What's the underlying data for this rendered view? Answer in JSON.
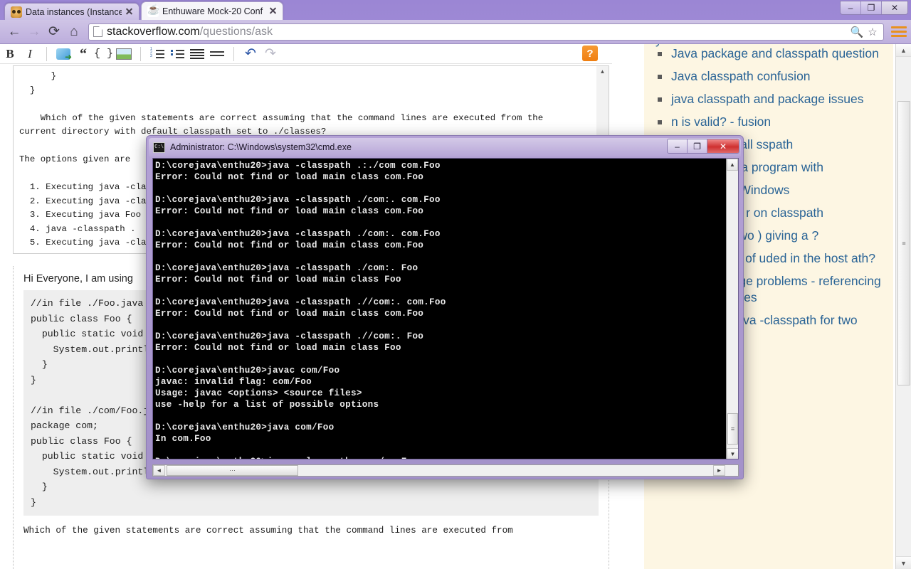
{
  "browser": {
    "tabs": [
      {
        "title": "Data instances (Instance)",
        "favicon": "face-icon",
        "active": false
      },
      {
        "title": "Enthuware Mock-20 Conf",
        "favicon": "java-icon",
        "active": true
      }
    ],
    "window_controls": {
      "minimize": "–",
      "maximize": "❐",
      "close": "✕"
    },
    "nav": {
      "back": "←",
      "forward": "→",
      "reload": "⟳",
      "home": "⌂"
    },
    "omnibox": {
      "url_domain": "stackoverflow.com",
      "url_path": "/questions/ask",
      "search_icon": "🔍",
      "bookmark_icon": "☆"
    },
    "menu_icon": "hamburger-menu-icon"
  },
  "editor": {
    "toolbar": [
      {
        "name": "bold-button",
        "label": "B"
      },
      {
        "name": "italic-button",
        "label": "I"
      },
      {
        "name": "hyperlink-button",
        "label": ""
      },
      {
        "name": "blockquote-button",
        "label": "“"
      },
      {
        "name": "code-sample-button",
        "label": "{ }"
      },
      {
        "name": "image-button",
        "label": ""
      },
      {
        "name": "numbered-list-button",
        "label": ""
      },
      {
        "name": "bulleted-list-button",
        "label": ""
      },
      {
        "name": "heading-button",
        "label": ""
      },
      {
        "name": "horizontal-rule-button",
        "label": ""
      },
      {
        "name": "undo-button",
        "label": "↶"
      },
      {
        "name": "redo-button",
        "label": "↷"
      }
    ],
    "help_label": "?",
    "body_text": "      }\n  }\n\n    Which of the given statements are correct assuming that the command lines are executed from the\ncurrent directory with default classpath set to ./classes?\n\nThe options given are\n\n  1. Executing java -classpath\n  2. Executing java -classpath\n  3. Executing java Foo\n  4. java -classpath .\n  5. Executing java -classpath\n\nCorrect option given i\ncommand line it gives",
    "scrollbar_up": "▲"
  },
  "preview": {
    "intro": "Hi Everyone, I am using",
    "code_block": "//in file ./Foo.java\npublic class Foo {\n  public static void main(String[] args) {\n    System.out.println(\"In Foo\");\n  }\n}\n\n//in file ./com/Foo.java\npackage com;\npublic class Foo {\n  public static void main(String[] args) {\n    System.out.println(\"In com.Foo\");\n  }\n}",
    "tail": "Which of the given statements are correct assuming that the command lines are executed from"
  },
  "sidebar": {
    "clipped_top": "y",
    "related": [
      "Java package and classpath question",
      "Java classpath confusion",
      "java classpath and package issues",
      "n is valid? - fusion",
      "and “.” in a call sspath",
      "ut compiling a program with",
      "arding Java Windows",
      "does not see r on classpath",
      "cting these two ) giving a ?",
      "ed packages of uded in the host ath?",
      "n and package problems - referencing multiple jar files",
      "How to set java -classpath for two directories?"
    ]
  },
  "page_scrollbar": {
    "up": "▲",
    "down": "▼",
    "grip": "≡"
  },
  "cmd": {
    "title": "Administrator: C:\\Windows\\system32\\cmd.exe",
    "icon_label": "C:\\",
    "controls": {
      "minimize": "–",
      "maximize": "❐",
      "close": "✕"
    },
    "console_text": "D:\\corejava\\enthu20>java -classpath .:./com com.Foo\nError: Could not find or load main class com.Foo\n\nD:\\corejava\\enthu20>java -classpath ./com:. com.Foo\nError: Could not find or load main class com.Foo\n\nD:\\corejava\\enthu20>java -classpath ./com:. com.Foo\nError: Could not find or load main class com.Foo\n\nD:\\corejava\\enthu20>java -classpath ./com:. Foo\nError: Could not find or load main class Foo\n\nD:\\corejava\\enthu20>java -classpath .//com:. com.Foo\nError: Could not find or load main class com.Foo\n\nD:\\corejava\\enthu20>java -classpath .//com:. Foo\nError: Could not find or load main class Foo\n\nD:\\corejava\\enthu20>javac com/Foo\njavac: invalid flag: com/Foo\nUsage: javac <options> <source files>\nuse -help for a list of possible options\n\nD:\\corejava\\enthu20>java com/Foo\nIn com.Foo\n\nD:\\corejava\\enthu20>java -classpath .com/:. Foo\nError: Could not find or load main class Foo\n\nD:\\corejava\\enthu20>java -classpath .com/:. com.Foo\nError: Could not find or load main class com.Foo\n\nD:\\corejava\\enthu20>java -classpath ./com:. com.Foo\nError: Could not find or load main class com.Foo\n\nD:\\corejava\\enthu20>",
    "vscroll": {
      "up": "▲",
      "down": "▼",
      "grip": "≡"
    },
    "hscroll": {
      "left": "◄",
      "right": "►",
      "grip": "⋯"
    }
  },
  "colors": {
    "chrome_purple": "#b4a2d6",
    "link_blue": "#2a6496",
    "sidebar_bg": "#fdf6e3",
    "accent_orange": "#ef7f12",
    "close_red": "#cf3030",
    "console_bg": "#000000"
  }
}
